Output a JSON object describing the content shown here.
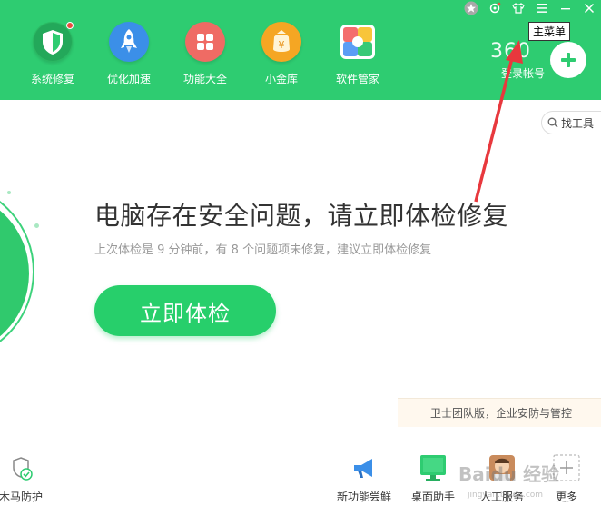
{
  "window": {
    "controls": {
      "skin_icon": "star-icon",
      "settings_icon": "gear-icon",
      "shirt_icon": "shirt-icon",
      "menu_icon": "menu-icon",
      "minimize_icon": "minimize-icon",
      "close_icon": "close-icon"
    },
    "tooltip": "主菜单"
  },
  "nav": {
    "items": [
      {
        "label": "系统修复",
        "icon": "shield-icon",
        "color": "#27ae60"
      },
      {
        "label": "优化加速",
        "icon": "rocket-icon",
        "color": "#3b8fe8"
      },
      {
        "label": "功能大全",
        "icon": "grid-icon",
        "color": "#ef6b64"
      },
      {
        "label": "小金库",
        "icon": "coin-icon",
        "color": "#f5a623"
      },
      {
        "label": "软件管家",
        "icon": "flower-icon",
        "color": "#ffffff"
      }
    ]
  },
  "account": {
    "brand": "360",
    "login_label": "登录帐号"
  },
  "search": {
    "label": "找工具"
  },
  "main": {
    "headline": "电脑存在安全问题，请立即体检修复",
    "subline": "上次体检是 9 分钟前，有 8 个问题项未修复，建议立即体检修复",
    "check_button": "立即体检",
    "team_banner": "卫士团队版，企业安防与管控"
  },
  "bottom": {
    "items": [
      {
        "label": "木马防护",
        "icon": "trojan-shield-icon"
      },
      {
        "label": "新功能尝鲜",
        "icon": "megaphone-icon"
      },
      {
        "label": "桌面助手",
        "icon": "monitor-icon"
      },
      {
        "label": "人工服务",
        "icon": "support-avatar-icon"
      },
      {
        "label": "更多",
        "icon": "plus-square-icon"
      }
    ]
  },
  "watermark": {
    "text": "Baidu 经验",
    "sub": "jingyan.baidu.com"
  },
  "colors": {
    "primary_green": "#2ecc71",
    "button_green": "#27cf6b",
    "annotation_arrow": "#e8383d"
  }
}
